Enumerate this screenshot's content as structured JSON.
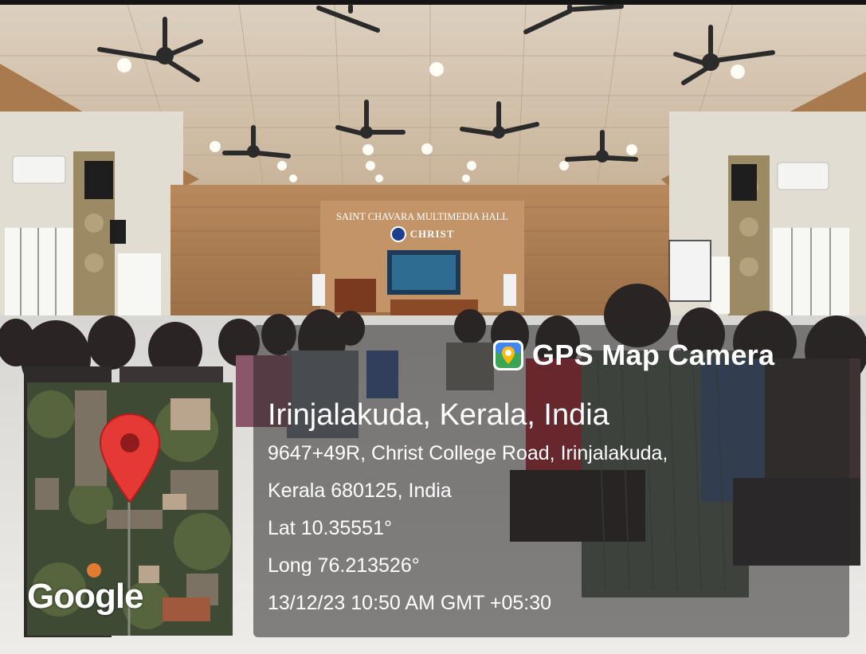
{
  "hall": {
    "title": "SAINT CHAVARA MULTIMEDIA HALL",
    "college_name": "CHRIST"
  },
  "watermark": {
    "brand": "GPS Map Camera",
    "place": "Irinjalakuda, Kerala, India",
    "address_line1": "9647+49R, Christ College Road, Irinjalakuda,",
    "address_line2": "Kerala 680125, India",
    "lat": "Lat 10.35551°",
    "long": "Long 76.213526°",
    "timestamp": "13/12/23 10:50 AM GMT +05:30",
    "map_provider": "Google"
  },
  "colors": {
    "pin_red": "#e53935",
    "overlay": "#2a2727",
    "text": "#ffffff"
  },
  "icons": [
    "gps-map-camera-app-icon",
    "map-pin-icon"
  ]
}
